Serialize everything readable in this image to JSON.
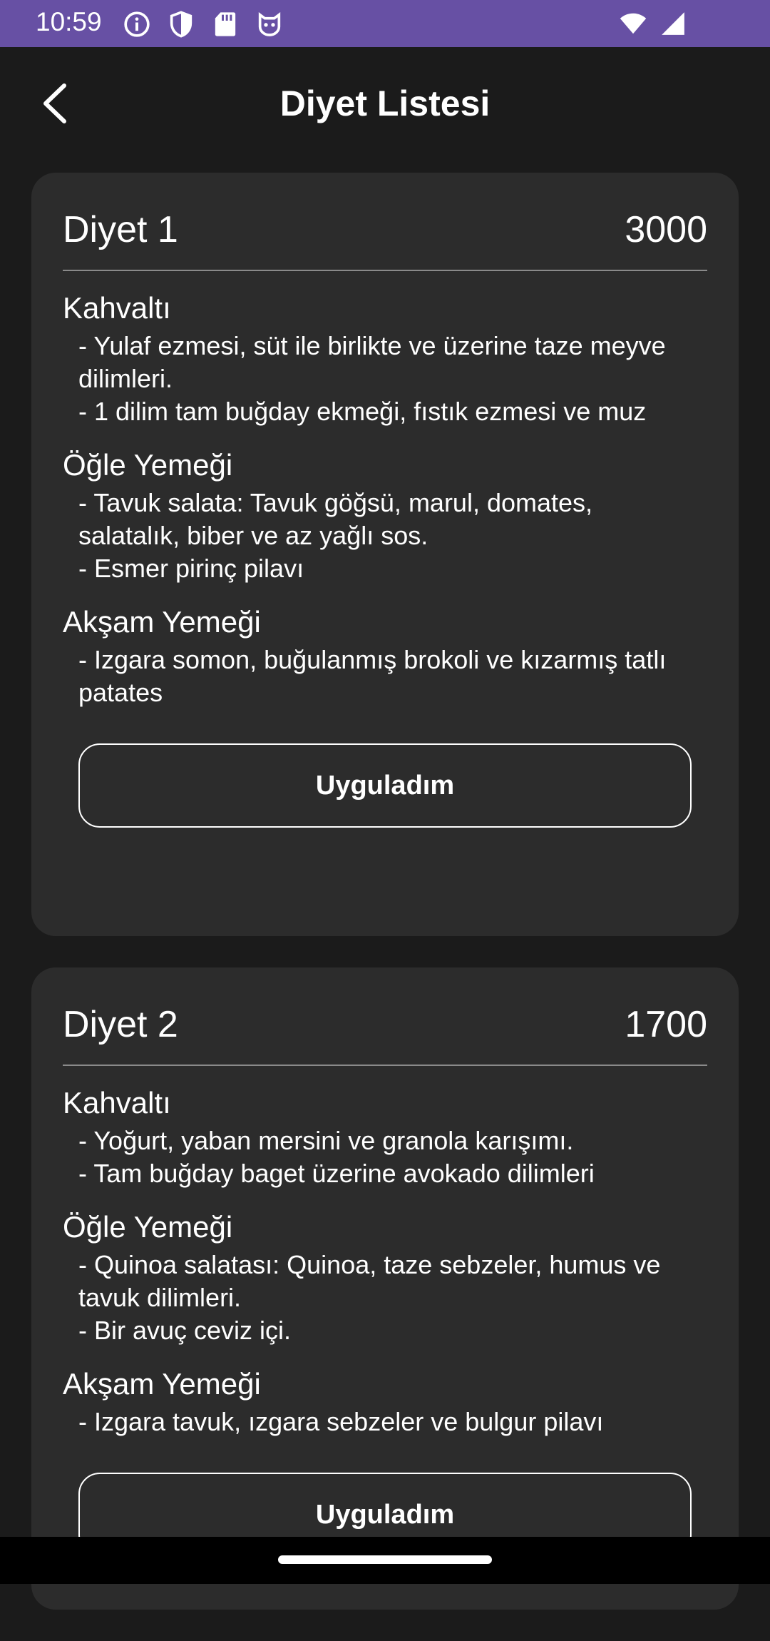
{
  "status_bar": {
    "time": "10:59",
    "icons_left": [
      "info-icon",
      "shield-icon",
      "sd-card-icon",
      "cat-icon"
    ],
    "icons_right": [
      "wifi-icon",
      "signal-icon"
    ]
  },
  "app_bar": {
    "title": "Diyet Listesi",
    "back_icon": "chevron-left-icon"
  },
  "diets": [
    {
      "name": "Diyet 1",
      "calories": "3000",
      "meals": [
        {
          "title": "Kahvaltı",
          "items": [
            "- Yulaf ezmesi, süt ile birlikte ve üzerine taze meyve dilimleri.",
            "- 1 dilim tam buğday ekmeği, fıstık ezmesi ve muz"
          ]
        },
        {
          "title": "Öğle Yemeği",
          "items": [
            "- Tavuk salata: Tavuk göğsü, marul, domates, salatalık, biber ve az yağlı sos.",
            "- Esmer pirinç pilavı"
          ]
        },
        {
          "title": "Akşam Yemeği",
          "items": [
            "- Izgara somon, buğulanmış brokoli ve kızarmış tatlı patates"
          ]
        }
      ],
      "button_label": "Uyguladım"
    },
    {
      "name": "Diyet 2",
      "calories": "1700",
      "meals": [
        {
          "title": "Kahvaltı",
          "items": [
            "- Yoğurt, yaban mersini ve granola karışımı.",
            "- Tam buğday baget üzerine avokado dilimleri"
          ]
        },
        {
          "title": "Öğle Yemeği",
          "items": [
            "- Quinoa salatası: Quinoa, taze sebzeler, humus ve tavuk dilimleri.",
            "- Bir avuç ceviz içi."
          ]
        },
        {
          "title": "Akşam Yemeği",
          "items": [
            "- Izgara tavuk, ızgara sebzeler ve bulgur pilavı"
          ]
        }
      ],
      "button_label": "Uyguladım"
    }
  ],
  "colors": {
    "status_bar": "#6750a4",
    "background": "#1b1b1b",
    "card": "#2c2c2c",
    "text": "#ffffff"
  }
}
